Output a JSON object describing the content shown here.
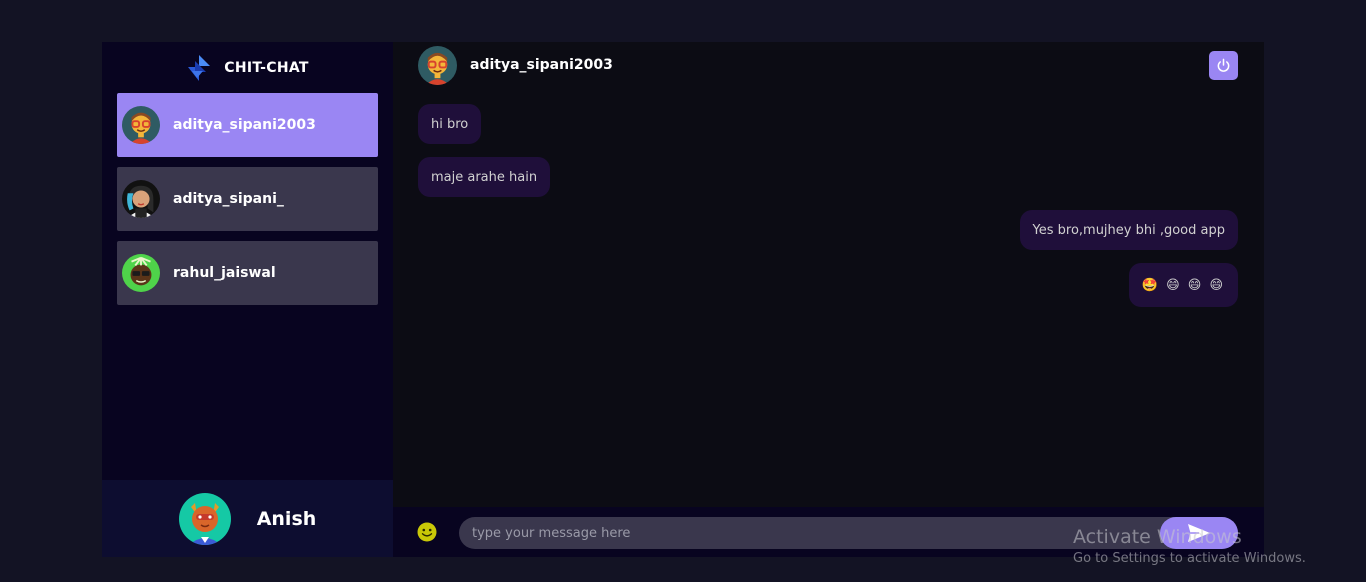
{
  "app": {
    "brand": "CHIT-CHAT"
  },
  "sidebar": {
    "contacts": [
      {
        "username": "aditya_sipani2003",
        "avatar_icon": "nerd-avatar-icon",
        "selected": true
      },
      {
        "username": "aditya_sipani_",
        "avatar_icon": "woman-avatar-icon",
        "selected": false
      },
      {
        "username": "rahul_jaiswal",
        "avatar_icon": "palm-avatar-icon",
        "selected": false
      }
    ],
    "current_user": {
      "username": "Anish",
      "avatar_icon": "cat-avatar-icon"
    }
  },
  "chat": {
    "header_username": "aditya_sipani2003",
    "messages": [
      {
        "text": "hi bro",
        "direction": "received"
      },
      {
        "text": "maje arahe hain",
        "direction": "received"
      },
      {
        "text": "Yes bro,mujhey bhi ,good app",
        "direction": "sent"
      },
      {
        "text": "🤩 😄 😄 😄",
        "direction": "sent"
      }
    ],
    "input": {
      "placeholder": "type your message here",
      "value": ""
    }
  },
  "watermark": {
    "line1": "Activate Windows",
    "line2": "Go to Settings to activate Windows."
  },
  "colors": {
    "accent": "#9a86f3",
    "sidebar_bg": "#080420",
    "bubble_bg": "#1f0f3a",
    "page_bg": "#131324"
  }
}
